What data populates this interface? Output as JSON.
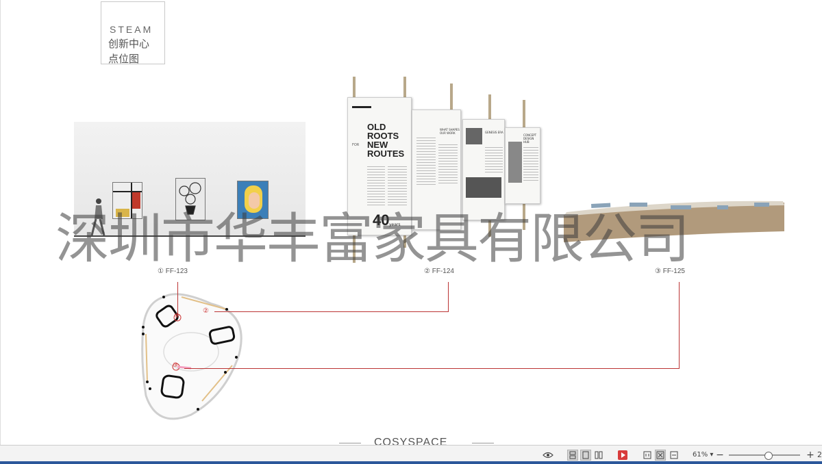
{
  "document": {
    "title_en": "STEAM",
    "title_cn_line1": "创新中心",
    "title_cn_line2": "点位图",
    "banner_title": [
      "OLD",
      "ROOTS",
      "NEW",
      "ROUTES"
    ],
    "banner_for": "FOR",
    "banner_years_num": "40",
    "banner_years_word": "years",
    "banner_small_heading_1": "WHAT SHAPES OUR WORK",
    "banner_small_heading_2": "GENESIS ERA",
    "banner_small_heading_3": "CONCEPT DESIGN HUB",
    "items": [
      {
        "label": "① FF-123"
      },
      {
        "label": "② FF-124"
      },
      {
        "label": "③ FF-125"
      }
    ],
    "plan_markers": [
      "①",
      "②",
      "③"
    ],
    "watermark": "深圳市华丰富家具有限公司",
    "brand": "COSYSPACE"
  },
  "statusbar": {
    "zoom": "61%",
    "zoom_minus": "−",
    "zoom_plus": "+",
    "zoom_level": 0.55,
    "trailing": "2"
  },
  "colors": {
    "leader": "#b33333",
    "counter": "#b19a7c",
    "accent_red": "#d83b3b",
    "taskbar": "#2b579a"
  }
}
